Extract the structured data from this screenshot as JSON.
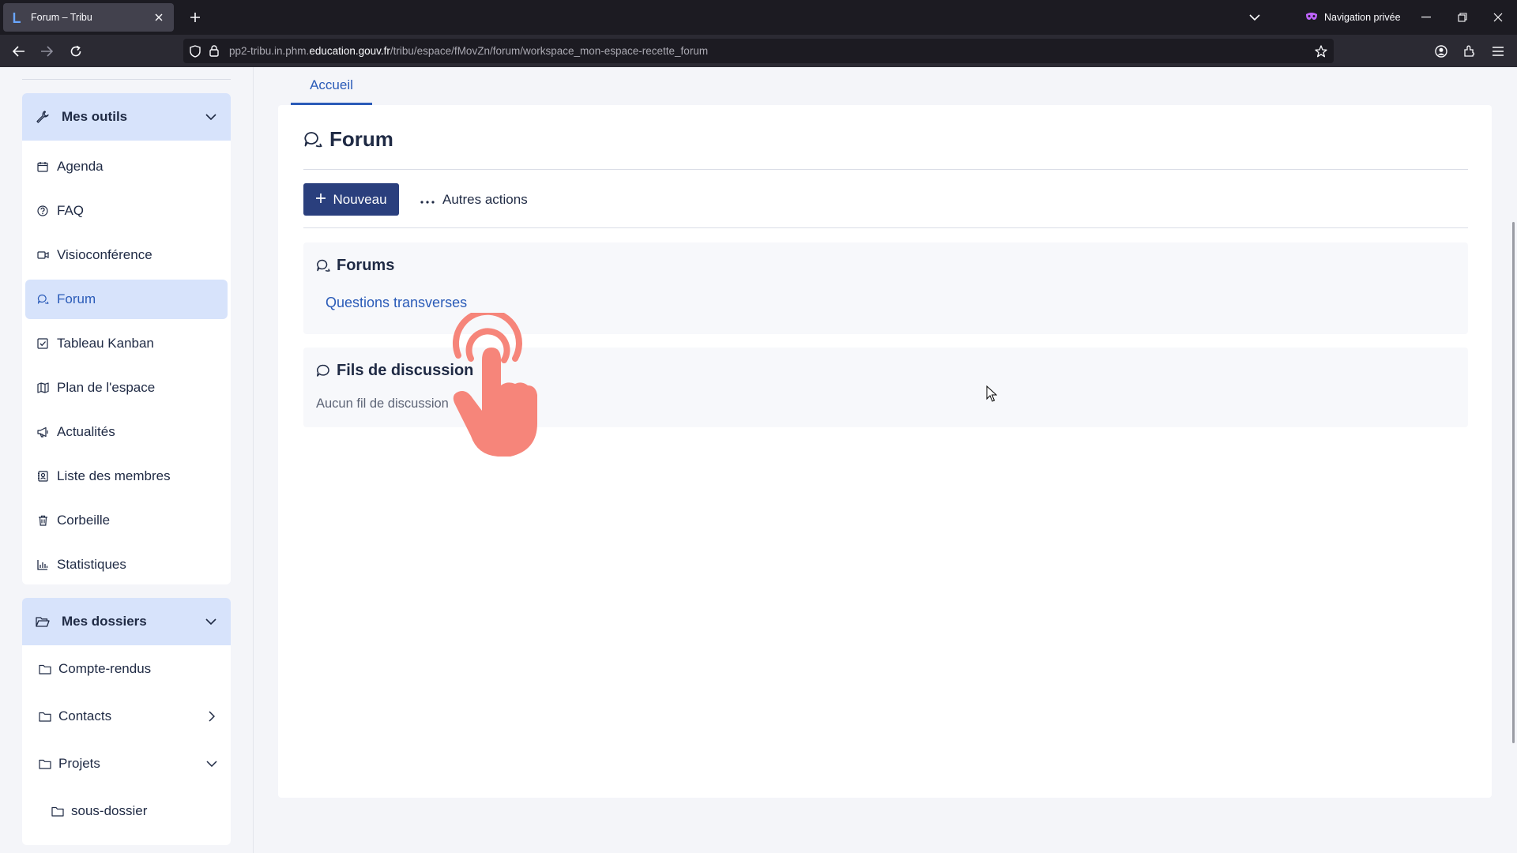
{
  "browser": {
    "tab_title": "Forum – Tribu",
    "private_label": "Navigation privée",
    "url_prefix": "pp2-tribu.in.phm.",
    "url_domain": "education.gouv.fr",
    "url_path": "/tribu/espace/fMovZn/forum/workspace_mon-espace-recette_forum"
  },
  "sidebar": {
    "tools_header": "Mes outils",
    "tools": [
      {
        "label": "Agenda",
        "icon": "calendar-icon"
      },
      {
        "label": "FAQ",
        "icon": "question-circle-icon"
      },
      {
        "label": "Visioconférence",
        "icon": "video-icon"
      },
      {
        "label": "Forum",
        "icon": "forum-icon",
        "active": true
      },
      {
        "label": "Tableau Kanban",
        "icon": "checkbox-icon"
      },
      {
        "label": "Plan de l'espace",
        "icon": "map-icon"
      },
      {
        "label": "Actualités",
        "icon": "megaphone-icon"
      },
      {
        "label": "Liste des membres",
        "icon": "members-icon"
      },
      {
        "label": "Corbeille",
        "icon": "trash-icon"
      },
      {
        "label": "Statistiques",
        "icon": "stats-icon"
      }
    ],
    "folders_header": "Mes dossiers",
    "folders": [
      {
        "label": "Compte-rendus"
      },
      {
        "label": "Contacts"
      },
      {
        "label": "Projets"
      },
      {
        "label": "sous-dossier"
      }
    ]
  },
  "main": {
    "tab_home": "Accueil",
    "title": "Forum",
    "new_button": "Nouveau",
    "more_actions": "Autres actions",
    "forums_section": "Forums",
    "forum_link": "Questions transverses",
    "threads_section": "Fils de discussion",
    "threads_empty": "Aucun fil de discussion"
  },
  "colors": {
    "accent": "#2a5bb8",
    "primary_button": "#2a3f7d",
    "sidebar_highlight": "#d7e3fb",
    "touch_indicator": "#f6857a"
  }
}
